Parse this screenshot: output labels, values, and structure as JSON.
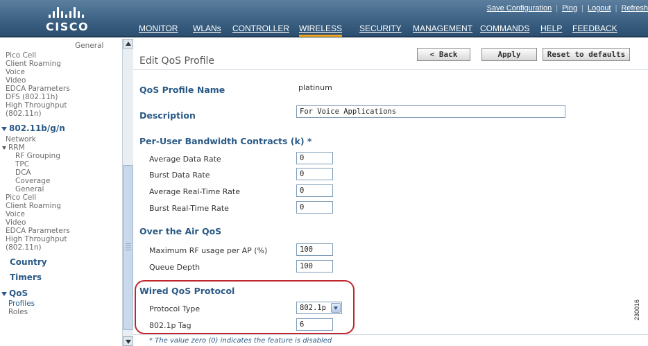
{
  "header": {
    "brand": "CISCO",
    "top_links": [
      "Save Configuration",
      "Ping",
      "Logout",
      "Refresh"
    ],
    "nav": [
      "MONITOR",
      "WLANs",
      "CONTROLLER",
      "WIRELESS",
      "SECURITY",
      "MANAGEMENT",
      "COMMANDS",
      "HELP",
      "FEEDBACK"
    ],
    "active_nav": "WIRELESS"
  },
  "sidebar": {
    "items_top": [
      "General",
      "Pico Cell",
      "Client Roaming",
      "Voice",
      "Video",
      "EDCA Parameters",
      "DFS (802.11h)",
      "High Throughput",
      "(802.11n)"
    ],
    "section_bgn": "802.11b/g/n",
    "items_bgn": [
      "Network",
      "RRM",
      "RF Grouping",
      "TPC",
      "DCA",
      "Coverage",
      "General",
      "Pico Cell",
      "Client Roaming",
      "Voice",
      "Video",
      "EDCA Parameters",
      "High Throughput",
      "(802.11n)"
    ],
    "country": "Country",
    "timers": "Timers",
    "qos": "QoS",
    "qos_items": [
      "Profiles",
      "Roles"
    ]
  },
  "page": {
    "title": "Edit QoS Profile",
    "back_button": "< Back",
    "apply_button": "Apply",
    "reset_button": "Reset to defaults",
    "profile_name_label": "QoS Profile Name",
    "profile_name_value": "platinum",
    "description_label": "Description",
    "description_value": "For Voice Applications",
    "bandwidth_section": "Per-User Bandwidth Contracts (k)",
    "bandwidth_asterisk": "*",
    "avg_data_rate_label": "Average Data Rate",
    "avg_data_rate_value": "0",
    "burst_data_rate_label": "Burst Data Rate",
    "burst_data_rate_value": "0",
    "avg_rt_rate_label": "Average Real-Time Rate",
    "avg_rt_rate_value": "0",
    "burst_rt_rate_label": "Burst Real-Time Rate",
    "burst_rt_rate_value": "0",
    "air_qos_section": "Over the Air QoS",
    "max_rf_label": "Maximum RF usage per AP (%)",
    "max_rf_value": "100",
    "queue_depth_label": "Queue Depth",
    "queue_depth_value": "100",
    "wired_section": "Wired QoS Protocol",
    "protocol_type_label": "Protocol Type",
    "protocol_type_value": "802.1p",
    "tag_label": "802.1p Tag",
    "tag_value": "6",
    "note": "* The value zero (0) indicates the feature is disabled",
    "figure_id": "230016"
  },
  "colors": {
    "header_bg": "#3d6284",
    "active_tab_underline": "#f2a31b",
    "label_blue": "#2a5a86",
    "highlight_red": "#c0272d"
  }
}
